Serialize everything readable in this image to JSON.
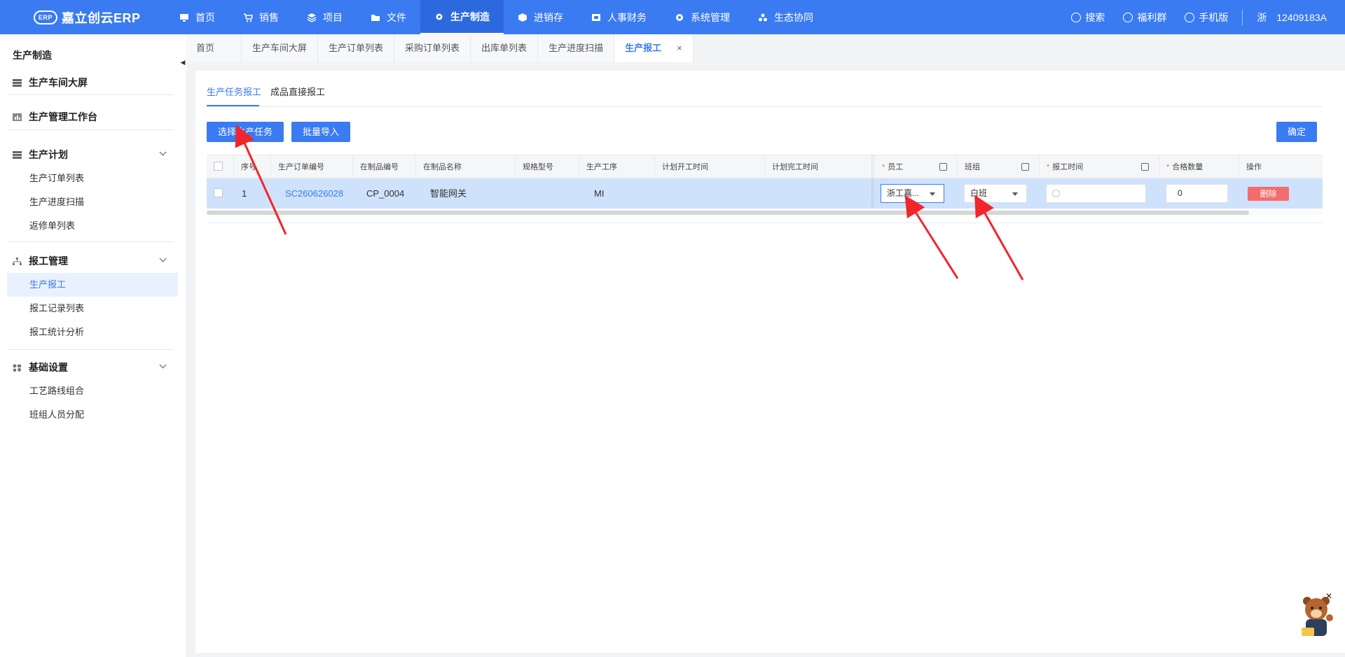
{
  "app": {
    "logo_text": "嘉立创云ERP",
    "logo_badge": "ERP"
  },
  "nav": [
    {
      "label": "首页",
      "icon": "monitor-icon"
    },
    {
      "label": "销售",
      "icon": "cart-icon"
    },
    {
      "label": "项目",
      "icon": "layers-icon"
    },
    {
      "label": "文件",
      "icon": "folder-icon"
    },
    {
      "label": "生产制造",
      "icon": "gear-icon"
    },
    {
      "label": "进销存",
      "icon": "box-icon"
    },
    {
      "label": "人事财务",
      "icon": "wallet-icon"
    },
    {
      "label": "系统管理",
      "icon": "settings-icon"
    },
    {
      "label": "生态协同",
      "icon": "ecology-icon"
    }
  ],
  "top_right": {
    "search": "搜索",
    "welfare": "福利群",
    "mobile": "手机版",
    "company_short": "浙",
    "account": "12409183A"
  },
  "sidebar": {
    "title": "生产制造",
    "groups": [
      {
        "label": "生产车间大屏"
      },
      {
        "label": "生产管理工作台"
      },
      {
        "label": "生产计划",
        "items": [
          "生产订单列表",
          "生产进度扫描",
          "返修单列表"
        ]
      },
      {
        "label": "报工管理",
        "items": [
          "生产报工",
          "报工记录列表",
          "报工统计分析"
        ]
      },
      {
        "label": "基础设置",
        "items": [
          "工艺路线组合",
          "班组人员分配"
        ]
      }
    ]
  },
  "tabs": [
    {
      "label": "首页"
    },
    {
      "label": "生产车间大屏"
    },
    {
      "label": "生产订单列表"
    },
    {
      "label": "采购订单列表"
    },
    {
      "label": "出库单列表"
    },
    {
      "label": "生产进度扫描"
    },
    {
      "label": "生产报工",
      "close": "×"
    }
  ],
  "subtabs": [
    "生产任务报工",
    "成品直接报工"
  ],
  "buttons": {
    "select_task": "选择生产任务",
    "batch_import": "批量导入",
    "confirm": "确定"
  },
  "table": {
    "headers": {
      "seq": "序号",
      "order_no": "生产订单编号",
      "wip_code": "在制品编号",
      "wip_name": "在制品名称",
      "spec": "规格型号",
      "process": "生产工序",
      "plan_start": "计划开工时间",
      "plan_end": "计划完工时间",
      "employee": "员工",
      "team": "班组",
      "report_time": "报工时间",
      "qualified": "合格数量",
      "ops": "操作"
    },
    "required_mark": "*",
    "row": {
      "seq": "1",
      "order_no": "SC260626028",
      "wip_code": "CP_0004",
      "wip_name": "智能网关",
      "spec": "",
      "process": "MI",
      "plan_start": "",
      "plan_end": "",
      "employee": "浙工嘉...",
      "team": "白班",
      "report_time": "",
      "qualified": "0",
      "delete": "删除"
    }
  },
  "colors": {
    "primary": "#3a7bf2",
    "danger": "#f56c6c",
    "row_selected": "#cfe2fb",
    "arrow": "#f0262a"
  }
}
